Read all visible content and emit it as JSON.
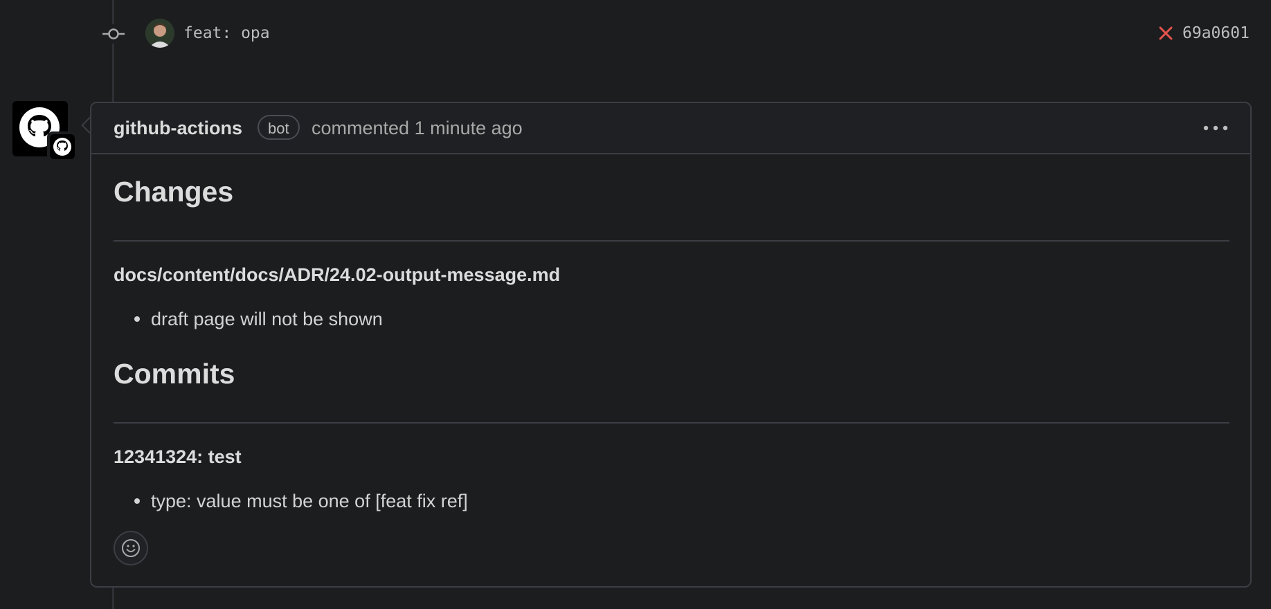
{
  "commit": {
    "message": "feat: opa",
    "sha": "69a0601",
    "status": "failed",
    "status_color": "#e5534b"
  },
  "comment": {
    "author": "github-actions",
    "badge": "bot",
    "meta": "commented 1 minute ago",
    "sections": [
      {
        "heading": "Changes",
        "subheading": "docs/content/docs/ADR/24.02-output-message.md",
        "bullets": [
          "draft page will not be shown"
        ]
      },
      {
        "heading": "Commits",
        "subheading": "12341324: test",
        "bullets": [
          "type: value must be one of [feat fix ref]"
        ]
      }
    ]
  },
  "icons": {
    "commit_node": "git-commit-icon",
    "status": "x-icon",
    "menu": "kebab-horizontal-icon",
    "reaction": "smiley-icon",
    "avatar": "github-mark-icon"
  },
  "colors": {
    "background": "#1c1d1f",
    "border": "#3b3e44",
    "error": "#e5534b"
  }
}
